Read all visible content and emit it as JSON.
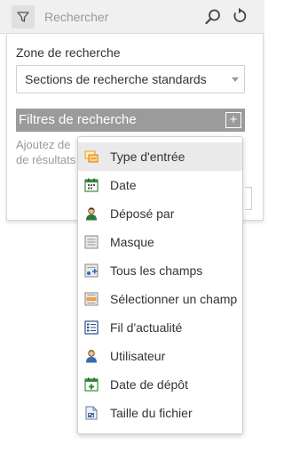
{
  "search": {
    "placeholder": "Rechercher",
    "filter_icon": "filter-icon",
    "search_icon": "search-icon",
    "reset_icon": "reset-icon"
  },
  "panel": {
    "zone_label": "Zone de recherche",
    "zone_value": "Sections de recherche standards",
    "filters_title": "Filtres de recherche",
    "add_label": "+",
    "hint_line1": "Ajoutez de",
    "hint_line2": "de résultats"
  },
  "menu": {
    "items": [
      {
        "label": "Type d'entrée",
        "icon": "entry-type-icon"
      },
      {
        "label": "Date",
        "icon": "calendar-icon"
      },
      {
        "label": "Déposé par",
        "icon": "user-icon"
      },
      {
        "label": "Masque",
        "icon": "mask-icon"
      },
      {
        "label": "Tous les champs",
        "icon": "all-fields-icon"
      },
      {
        "label": "Sélectionner un champ",
        "icon": "select-field-icon"
      },
      {
        "label": "Fil d'actualité",
        "icon": "news-feed-icon"
      },
      {
        "label": "Utilisateur",
        "icon": "user-icon"
      },
      {
        "label": "Date de dépôt",
        "icon": "calendar-add-icon"
      },
      {
        "label": "Taille du fichier",
        "icon": "file-size-icon"
      }
    ]
  },
  "colors": {
    "header_bg": "#9b9b9b",
    "highlight_bg": "#eaeaea",
    "searchbar_bg": "#f0f0f0"
  }
}
